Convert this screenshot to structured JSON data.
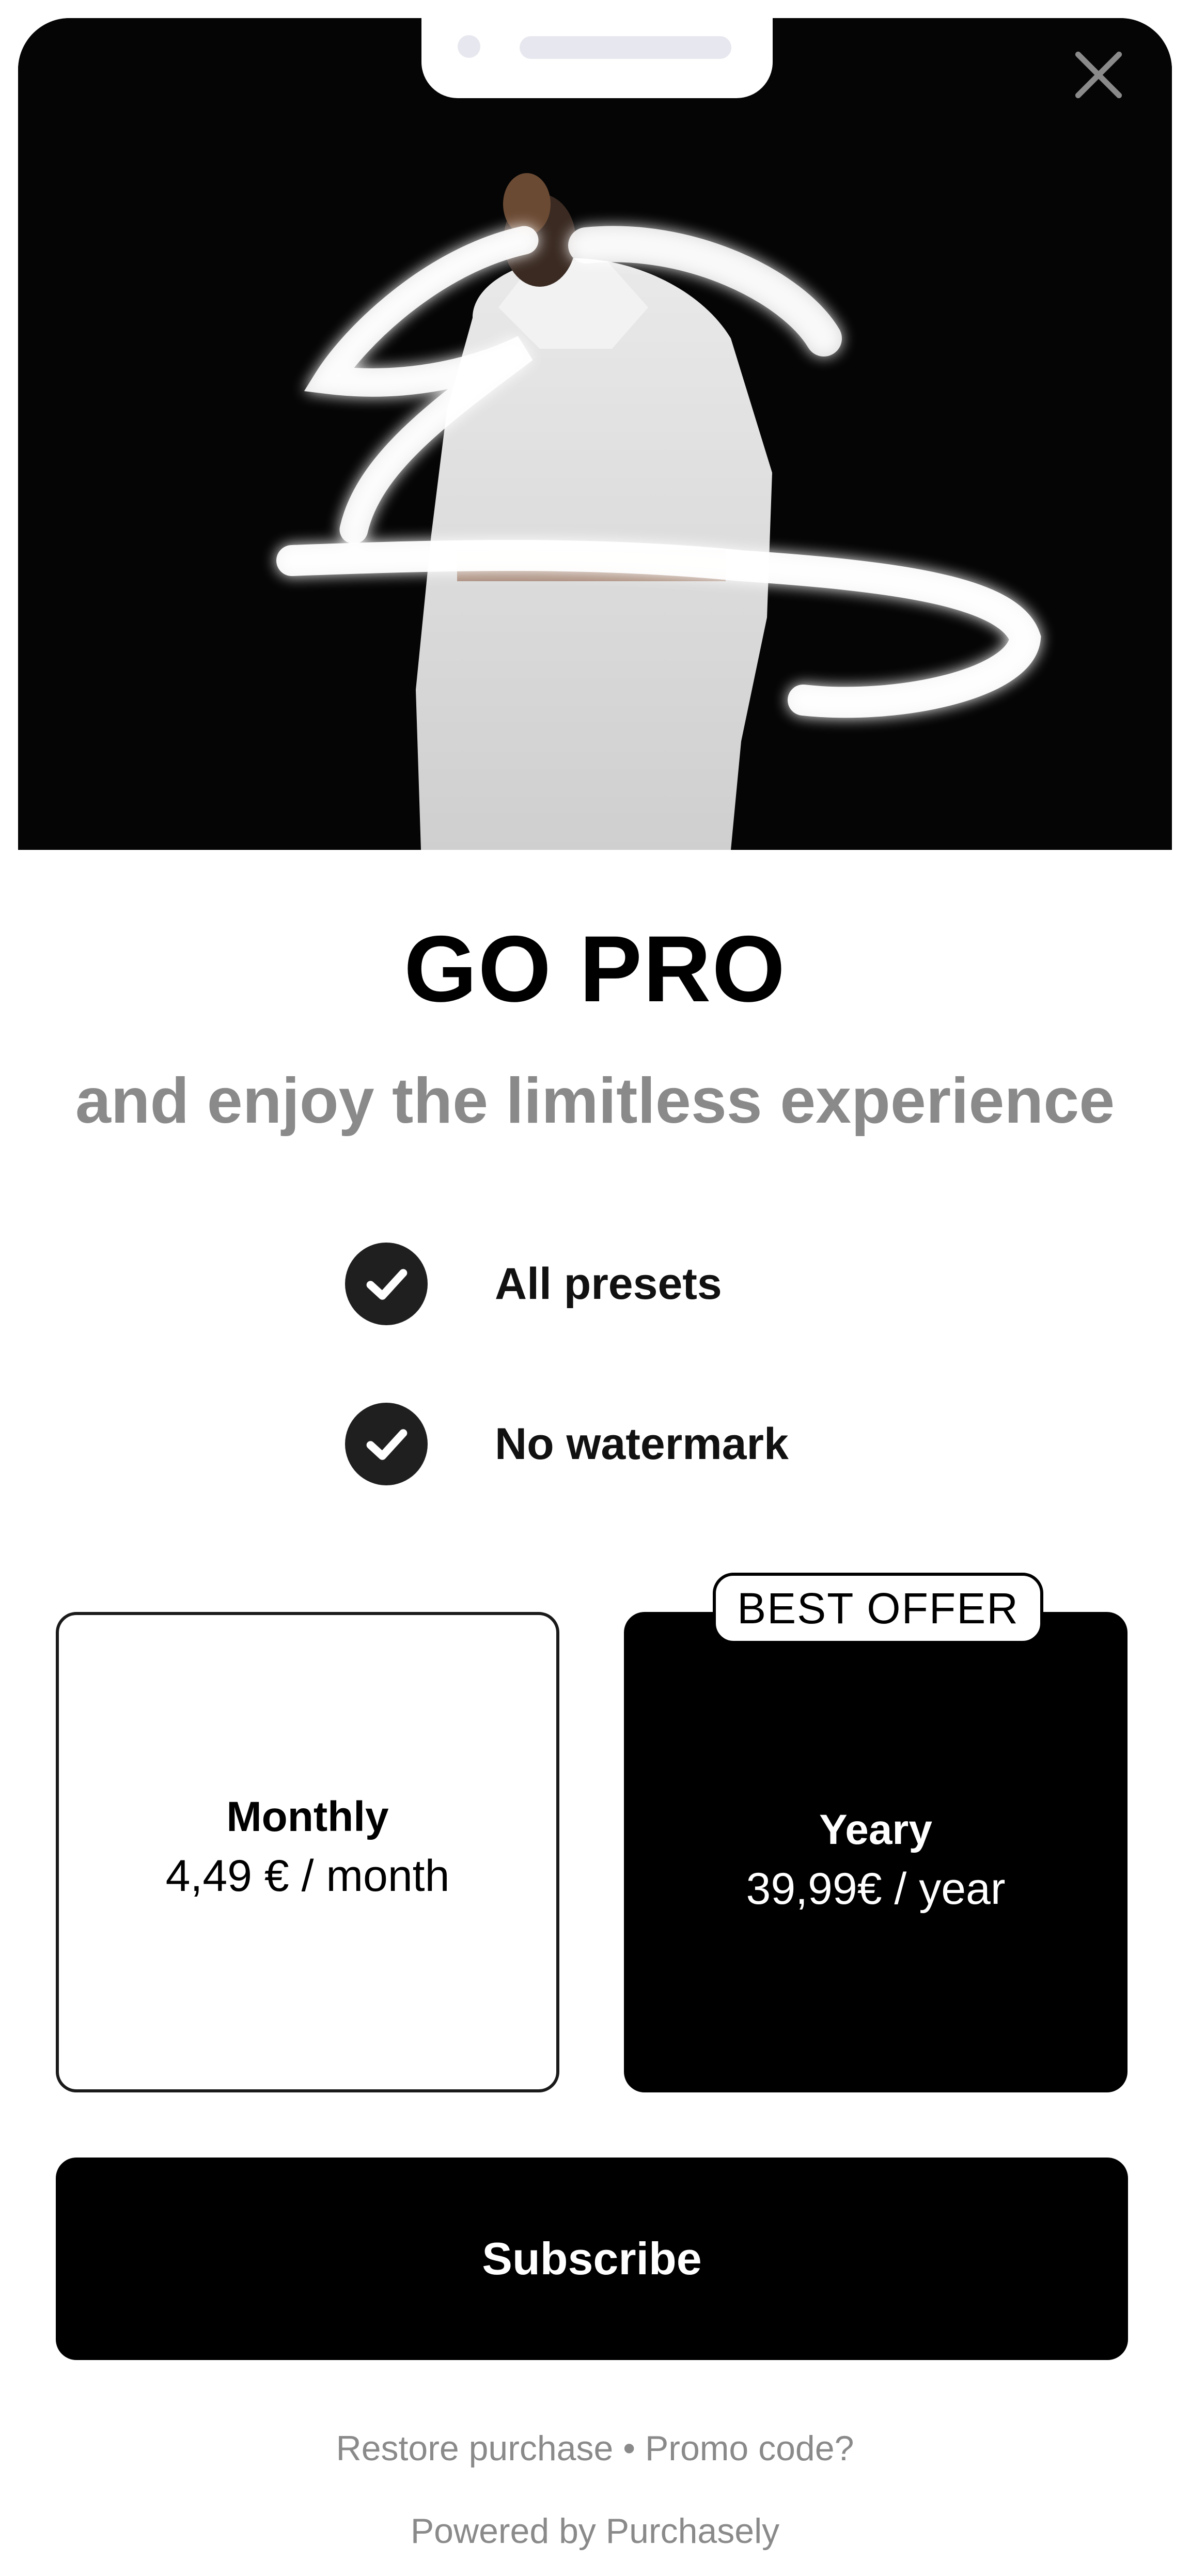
{
  "hero": {
    "image": "photo of a person in a white suit with light-painting streaks on a black background",
    "close_icon": "close-icon"
  },
  "header": {
    "title": "GO PRO",
    "subtitle": "and enjoy the limitless experience"
  },
  "features": [
    {
      "label": "All presets",
      "icon": "checkmark-circle-icon"
    },
    {
      "label": "No watermark",
      "icon": "checkmark-circle-icon"
    }
  ],
  "plans": {
    "monthly": {
      "name": "Monthly",
      "price": "4,49 € / month"
    },
    "yearly": {
      "name": "Yeary",
      "price": "39,99€ / year",
      "badge": "BEST OFFER"
    }
  },
  "cta": {
    "subscribe_label": "Subscribe"
  },
  "footer": {
    "restore_label": "Restore purchase",
    "separator": "•",
    "promo_label": "Promo code?",
    "powered_by": "Powered by Purchasely"
  },
  "colors": {
    "accent": "#000000",
    "muted_text": "#8a8a8a",
    "background": "#ffffff"
  }
}
